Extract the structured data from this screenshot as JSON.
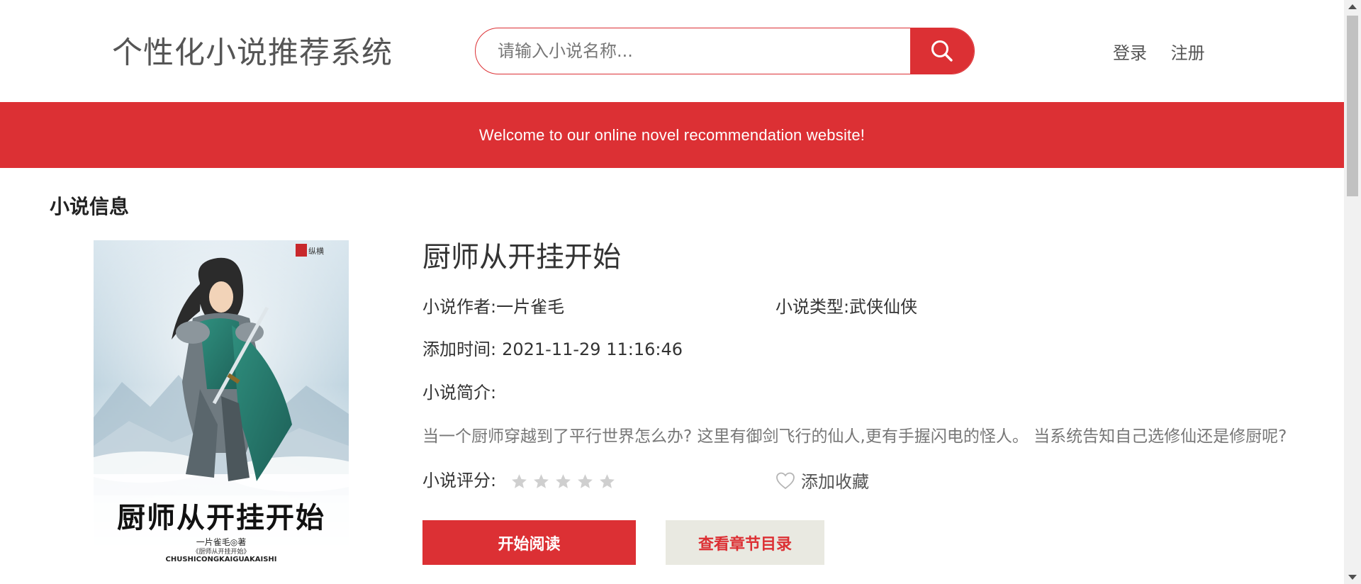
{
  "header": {
    "site_title": "个性化小说推荐系统",
    "search_placeholder": "请输入小说名称...",
    "search_icon": "search-icon",
    "login_label": "登录",
    "register_label": "注册"
  },
  "banner": {
    "text": "Welcome to our online novel recommendation website!"
  },
  "section": {
    "title": "小说信息"
  },
  "cover": {
    "title_calligraphy": "厨师从开挂开始",
    "author_line": "一片雀毛◎著",
    "subtitle_line": "《厨师从开挂开始》",
    "pinyin_line": "CHUSHICONGKAIGUAKAISHI",
    "publisher_mark": "纵横"
  },
  "novel": {
    "title": "厨师从开挂开始",
    "author_label": "小说作者:",
    "author": "一片雀毛",
    "type_label": "小说类型:",
    "type": "武侠仙侠",
    "added_label": "添加时间:",
    "added_time": "2021-11-29 11:16:46",
    "intro_label": "小说简介:",
    "intro": "当一个厨师穿越到了平行世界怎么办?   这里有御剑飞行的仙人,更有手握闪电的怪人。  当系统告知自己选修仙还是修厨呢?",
    "rating_label": "小说评分:",
    "rating": 0,
    "rating_max": 5,
    "favorite_label": "添加收藏"
  },
  "actions": {
    "read_label": "开始阅读",
    "chapters_label": "查看章节目录"
  },
  "colors": {
    "accent": "#dc3034",
    "button_secondary_bg": "#e9e9e1",
    "star_empty": "#cfcfcf"
  }
}
